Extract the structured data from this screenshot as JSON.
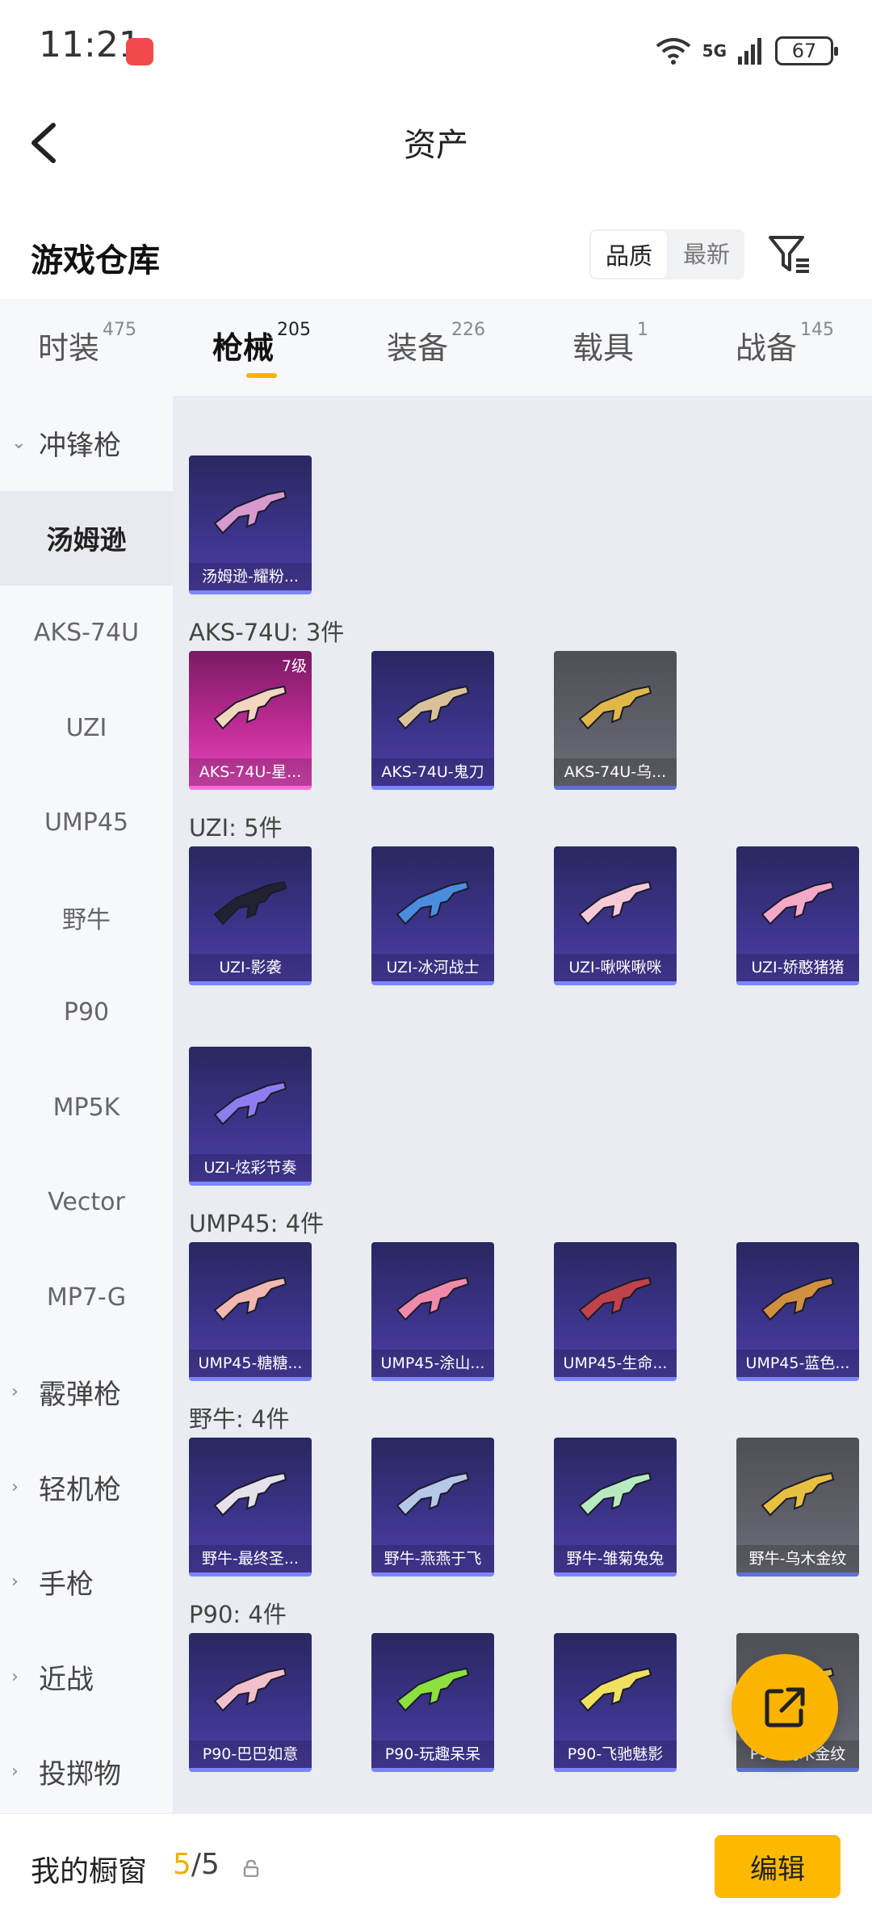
{
  "status_bar": {
    "time": "11:21",
    "network": "5G",
    "battery": "67"
  },
  "header": {
    "title": "资产"
  },
  "warehouse": {
    "title": "游戏仓库",
    "sort_options": [
      {
        "label": "品质",
        "active": true
      },
      {
        "label": "最新",
        "active": false
      }
    ]
  },
  "tabs": [
    {
      "label": "时装",
      "count": "475"
    },
    {
      "label": "枪械",
      "count": "205"
    },
    {
      "label": "装备",
      "count": "226"
    },
    {
      "label": "载具",
      "count": "1"
    },
    {
      "label": "战备",
      "count": "145"
    }
  ],
  "sidebar": [
    {
      "label": "冲锋枪",
      "type": "category",
      "expanded": true
    },
    {
      "label": "汤姆逊",
      "type": "sub",
      "selected": true
    },
    {
      "label": "AKS-74U",
      "type": "sub"
    },
    {
      "label": "UZI",
      "type": "sub"
    },
    {
      "label": "UMP45",
      "type": "sub"
    },
    {
      "label": "野牛",
      "type": "sub"
    },
    {
      "label": "P90",
      "type": "sub"
    },
    {
      "label": "MP5K",
      "type": "sub"
    },
    {
      "label": "Vector",
      "type": "sub"
    },
    {
      "label": "MP7-G",
      "type": "sub"
    },
    {
      "label": "霰弹枪",
      "type": "category",
      "expanded": false
    },
    {
      "label": "轻机枪",
      "type": "category",
      "expanded": false
    },
    {
      "label": "手枪",
      "type": "category",
      "expanded": false
    },
    {
      "label": "近战",
      "type": "category",
      "expanded": false
    },
    {
      "label": "投掷物",
      "type": "category",
      "expanded": false
    }
  ],
  "sections": [
    {
      "label": "",
      "items": [
        {
          "name": "汤姆逊-耀粉...",
          "rarity": "purple",
          "gun_color": "#d79ad0"
        }
      ]
    },
    {
      "label": "AKS-74U: 3件",
      "items": [
        {
          "name": "AKS-74U-星...",
          "rarity": "pink",
          "level": "7级",
          "gun_color": "#f3d6c0"
        },
        {
          "name": "AKS-74U-鬼刀",
          "rarity": "purple",
          "gun_color": "#d9c29a"
        },
        {
          "name": "AKS-74U-乌...",
          "rarity": "gray",
          "gun_color": "#e0b84a"
        }
      ]
    },
    {
      "label": "UZI: 5件",
      "items": [
        {
          "name": "UZI-影袭",
          "rarity": "purple",
          "gun_color": "#222233"
        },
        {
          "name": "UZI-冰河战士",
          "rarity": "purple",
          "gun_color": "#4a8de0"
        },
        {
          "name": "UZI-啾咪啾咪",
          "rarity": "purple",
          "gun_color": "#f4c9d8"
        },
        {
          "name": "UZI-娇憨猪猪",
          "rarity": "purple",
          "gun_color": "#f5a8c8"
        },
        {
          "name": "UZI-炫彩节奏",
          "rarity": "purple",
          "gun_color": "#8f7cf0"
        }
      ]
    },
    {
      "label": "UMP45: 4件",
      "items": [
        {
          "name": "UMP45-糖糖...",
          "rarity": "purple",
          "gun_color": "#f0b8b0"
        },
        {
          "name": "UMP45-涂山...",
          "rarity": "purple",
          "gun_color": "#f08aaa"
        },
        {
          "name": "UMP45-生命...",
          "rarity": "purple",
          "gun_color": "#c0424a"
        },
        {
          "name": "UMP45-蓝色...",
          "rarity": "purple",
          "gun_color": "#d09040"
        }
      ]
    },
    {
      "label": "野牛: 4件",
      "items": [
        {
          "name": "野牛-最终圣...",
          "rarity": "purple",
          "gun_color": "#e6e0ea"
        },
        {
          "name": "野牛-燕燕于飞",
          "rarity": "purple",
          "gun_color": "#b6c8e8"
        },
        {
          "name": "野牛-雏菊兔兔",
          "rarity": "purple",
          "gun_color": "#b8eac0"
        },
        {
          "name": "野牛-乌木金纹",
          "rarity": "gray",
          "gun_color": "#e8c040"
        }
      ]
    },
    {
      "label": "P90: 4件",
      "items": [
        {
          "name": "P90-巴巴如意",
          "rarity": "purple",
          "gun_color": "#f2c0cc"
        },
        {
          "name": "P90-玩趣呆呆",
          "rarity": "purple",
          "gun_color": "#8ce040"
        },
        {
          "name": "P90-飞驰魅影",
          "rarity": "purple",
          "gun_color": "#f0e060"
        },
        {
          "name": "P90-乌木金纹",
          "rarity": "gray",
          "gun_color": "#e8c040"
        }
      ]
    }
  ],
  "bottom_bar": {
    "label": "我的橱窗",
    "current": "5",
    "total": "/5",
    "edit_label": "编辑"
  }
}
